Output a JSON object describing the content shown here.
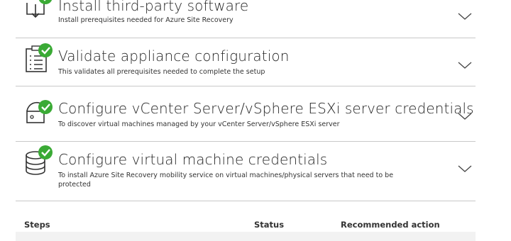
{
  "sections": [
    {
      "title": "Install third-party software",
      "description": "Install prerequisites needed for Azure Site Recovery",
      "icon": "install-download-icon",
      "status_icon": "check-icon"
    },
    {
      "title": "Validate appliance configuration",
      "description": "This validates all prerequisites needed to complete the setup",
      "icon": "checklist-icon",
      "status_icon": "check-icon"
    },
    {
      "title": "Configure vCenter Server/vSphere ESXi server credentials",
      "description": "To discover virtual machines managed by your vCenter Server/vSphere ESXi server",
      "icon": "server-credentials-icon",
      "status_icon": "check-icon"
    },
    {
      "title": "Configure virtual machine credentials",
      "description": "To install Azure Site Recovery mobility service on virtual machines/physical servers that need to be protected",
      "icon": "database-icon",
      "status_icon": "check-icon"
    }
  ],
  "steps_table": {
    "columns": [
      "Steps",
      "Status",
      "Recommended action"
    ]
  },
  "colors": {
    "success": "#3aaa35",
    "divider": "#c8c8c8",
    "band": "#f2f2f2"
  }
}
